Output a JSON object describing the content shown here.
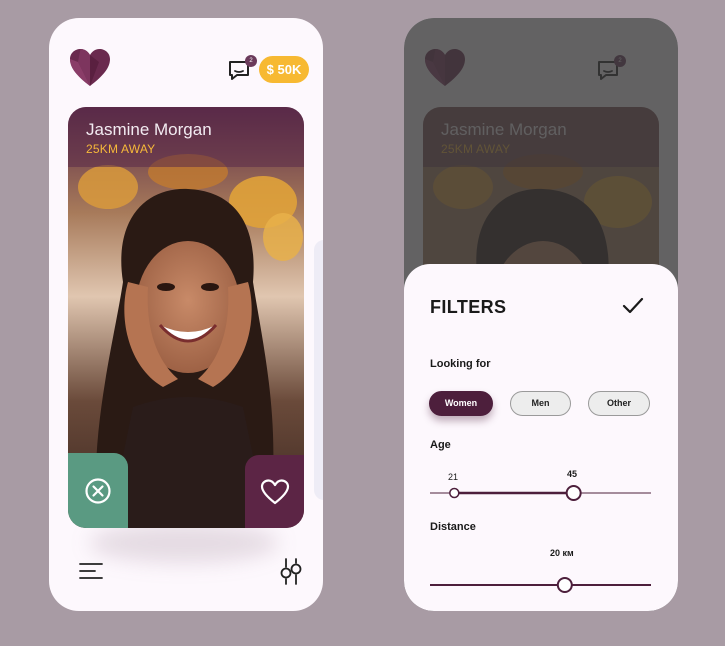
{
  "profile": {
    "name": "Jasmine Morgan",
    "distance": "25KM AWAY"
  },
  "header": {
    "chat_badge_count": "2",
    "coin_balance": "$ 50K"
  },
  "filters": {
    "title": "FILTERS",
    "looking_for_label": "Looking for",
    "options": [
      "Women",
      "Men",
      "Other"
    ],
    "selected_option": "Women",
    "age_label": "Age",
    "age_min": "21",
    "age_max": "45",
    "age_range_fraction": [
      0.11,
      0.65
    ],
    "distance_label": "Distance",
    "distance_value": "20 км",
    "distance_fraction": 0.61
  },
  "icons": {
    "logo": "heart-logo-icon",
    "chat": "chat-icon",
    "reject": "close-circle-icon",
    "like": "heart-outline-icon",
    "menu": "menu-icon",
    "filters": "sliders-icon",
    "confirm": "checkmark-icon"
  },
  "colors": {
    "accent": "#4d1f3c",
    "reject": "#5a9a82",
    "like": "#5c2545",
    "coins": "#f7b932",
    "distance_text": "#f6b83a"
  }
}
